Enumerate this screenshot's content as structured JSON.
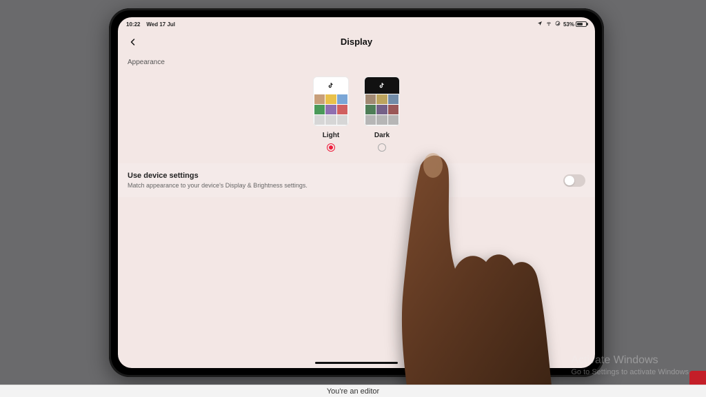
{
  "statusbar": {
    "time": "10:22",
    "date": "Wed 17 Jul",
    "battery_percent": "53%"
  },
  "header": {
    "title": "Display"
  },
  "section": {
    "label": "Appearance"
  },
  "themes": {
    "light": {
      "label": "Light",
      "selected": true
    },
    "dark": {
      "label": "Dark",
      "selected": false
    }
  },
  "device_setting": {
    "title": "Use device settings",
    "subtitle": "Match appearance to your device's Display & Brightness settings.",
    "enabled": false
  },
  "watermark": {
    "line1": "Activate Windows",
    "line2": "Go to Settings to activate Windows."
  },
  "bottombar": {
    "text": "You're an editor"
  }
}
